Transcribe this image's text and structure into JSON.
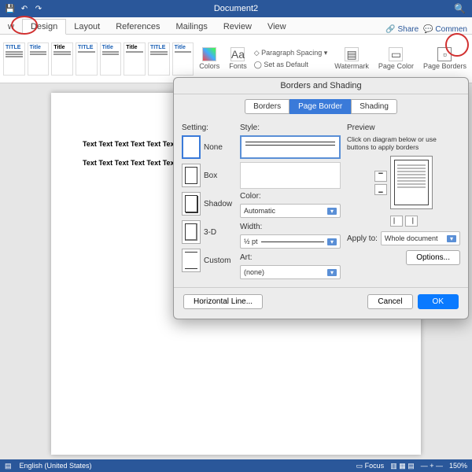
{
  "title": "Document2",
  "tabs": [
    "w",
    "Design",
    "Layout",
    "References",
    "Mailings",
    "Review",
    "View"
  ],
  "activeTab": "Design",
  "share": "Share",
  "comments": "Commen",
  "ribbon": {
    "colors": "Colors",
    "fonts": "Fonts",
    "paraSpacing": "Paragraph Spacing",
    "setDefault": "Set as Default",
    "watermark": "Watermark",
    "pageColor": "Page Color",
    "pageBorders": "Page Borders"
  },
  "page": {
    "line1": "Text Text Text Text Text Text Te",
    "line2": "Text Text Text Text Text Text Te"
  },
  "dialog": {
    "title": "Borders and Shading",
    "tabs": [
      "Borders",
      "Page Border",
      "Shading"
    ],
    "activeTab": "Page Border",
    "settingLabel": "Setting:",
    "settings": [
      "None",
      "Box",
      "Shadow",
      "3-D",
      "Custom"
    ],
    "styleLabel": "Style:",
    "colorLabel": "Color:",
    "colorValue": "Automatic",
    "widthLabel": "Width:",
    "widthValue": "½ pt",
    "artLabel": "Art:",
    "artValue": "(none)",
    "previewLabel": "Preview",
    "previewHint": "Click on diagram below or use buttons to apply borders",
    "applyToLabel": "Apply to:",
    "applyToValue": "Whole document",
    "options": "Options...",
    "hline": "Horizontal Line...",
    "cancel": "Cancel",
    "ok": "OK"
  },
  "status": {
    "lang": "English (United States)",
    "focus": "Focus",
    "zoom": "150%"
  }
}
